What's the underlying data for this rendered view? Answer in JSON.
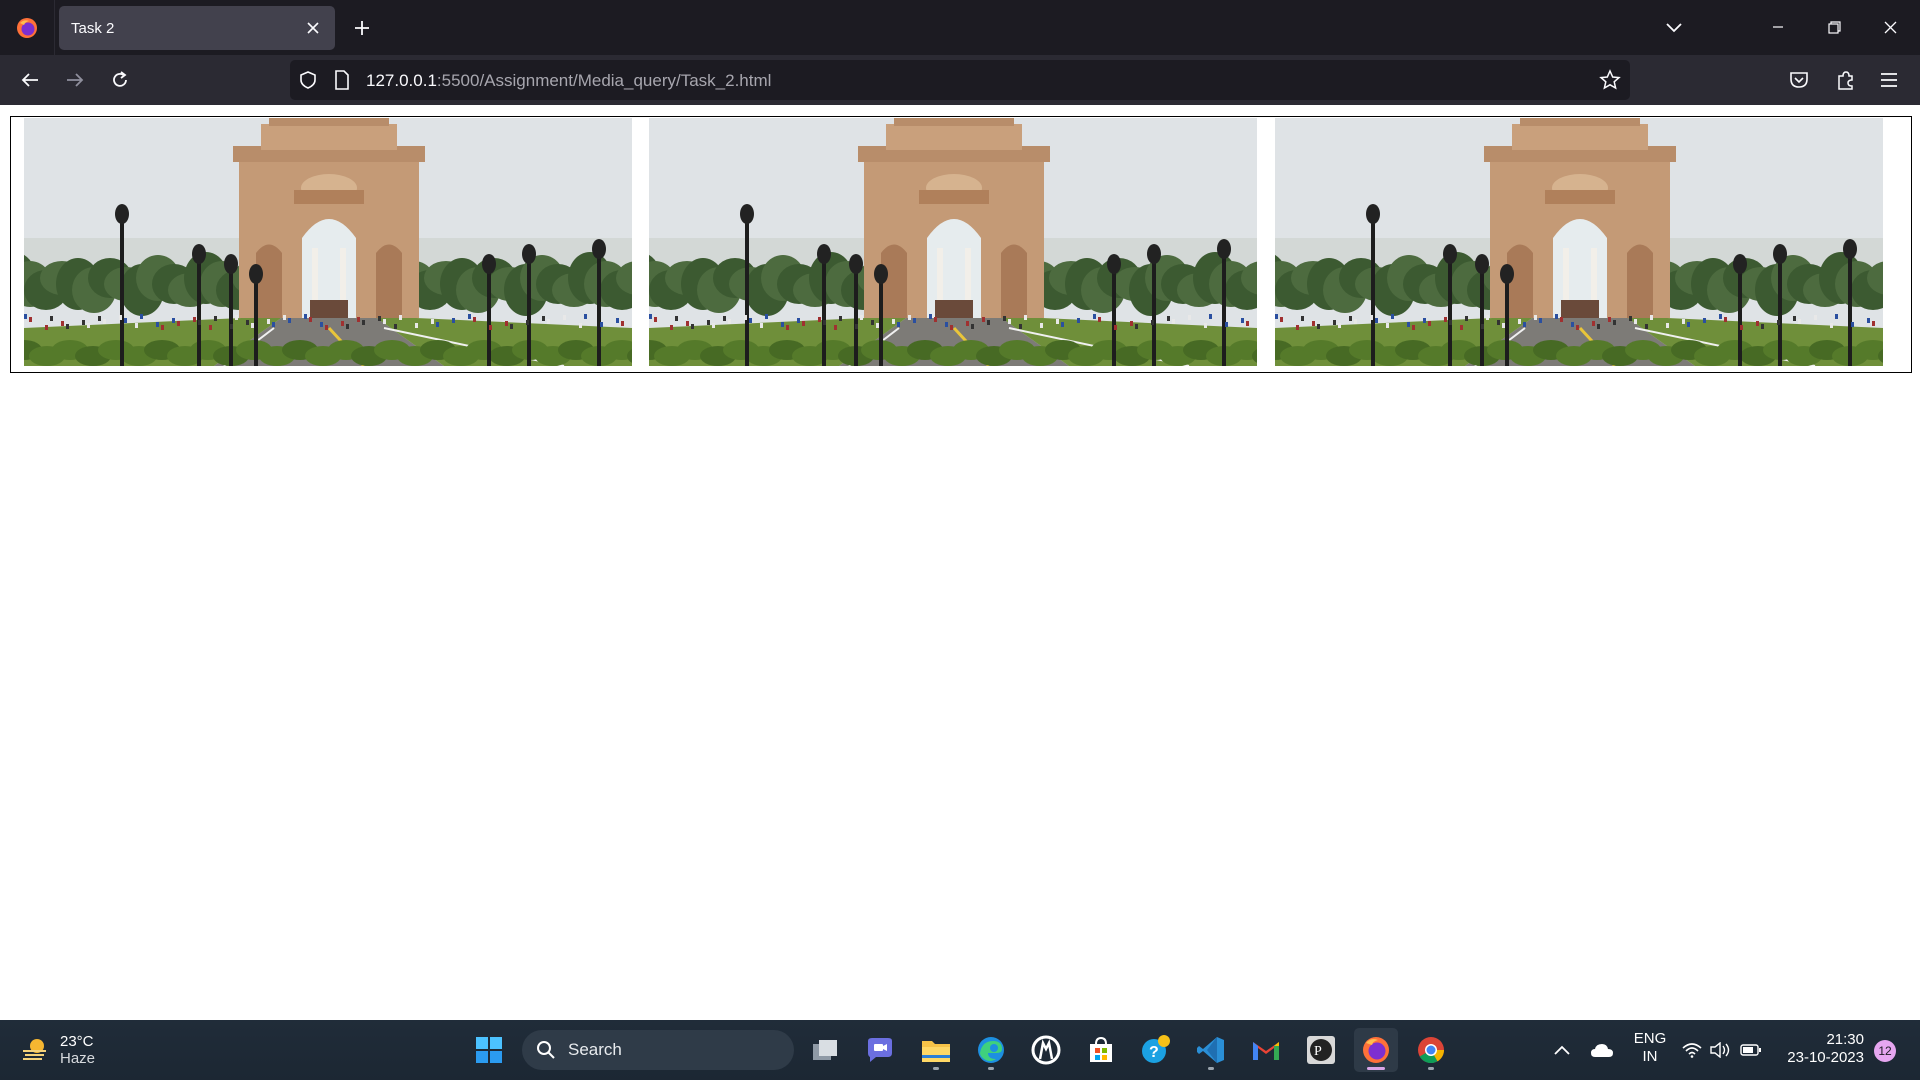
{
  "browser": {
    "tab_title": "Task 2",
    "url_host": "127.0.0.1",
    "url_rest": ":5500/Assignment/Media_query/Task_2.html"
  },
  "page": {
    "images": [
      {
        "alt": "India Gate"
      },
      {
        "alt": "India Gate"
      },
      {
        "alt": "India Gate"
      }
    ]
  },
  "taskbar": {
    "weather_temp": "23°C",
    "weather_condition": "Haze",
    "search_placeholder": "Search",
    "language": "ENG",
    "region": "IN",
    "time": "21:30",
    "date": "23-10-2023",
    "notification_count": "12"
  },
  "colors": {
    "tabbar_bg": "#1c1b22",
    "navbar_bg": "#2b2a33",
    "active_tab_bg": "#42414d",
    "taskbar_bg": "#1f2b38"
  }
}
